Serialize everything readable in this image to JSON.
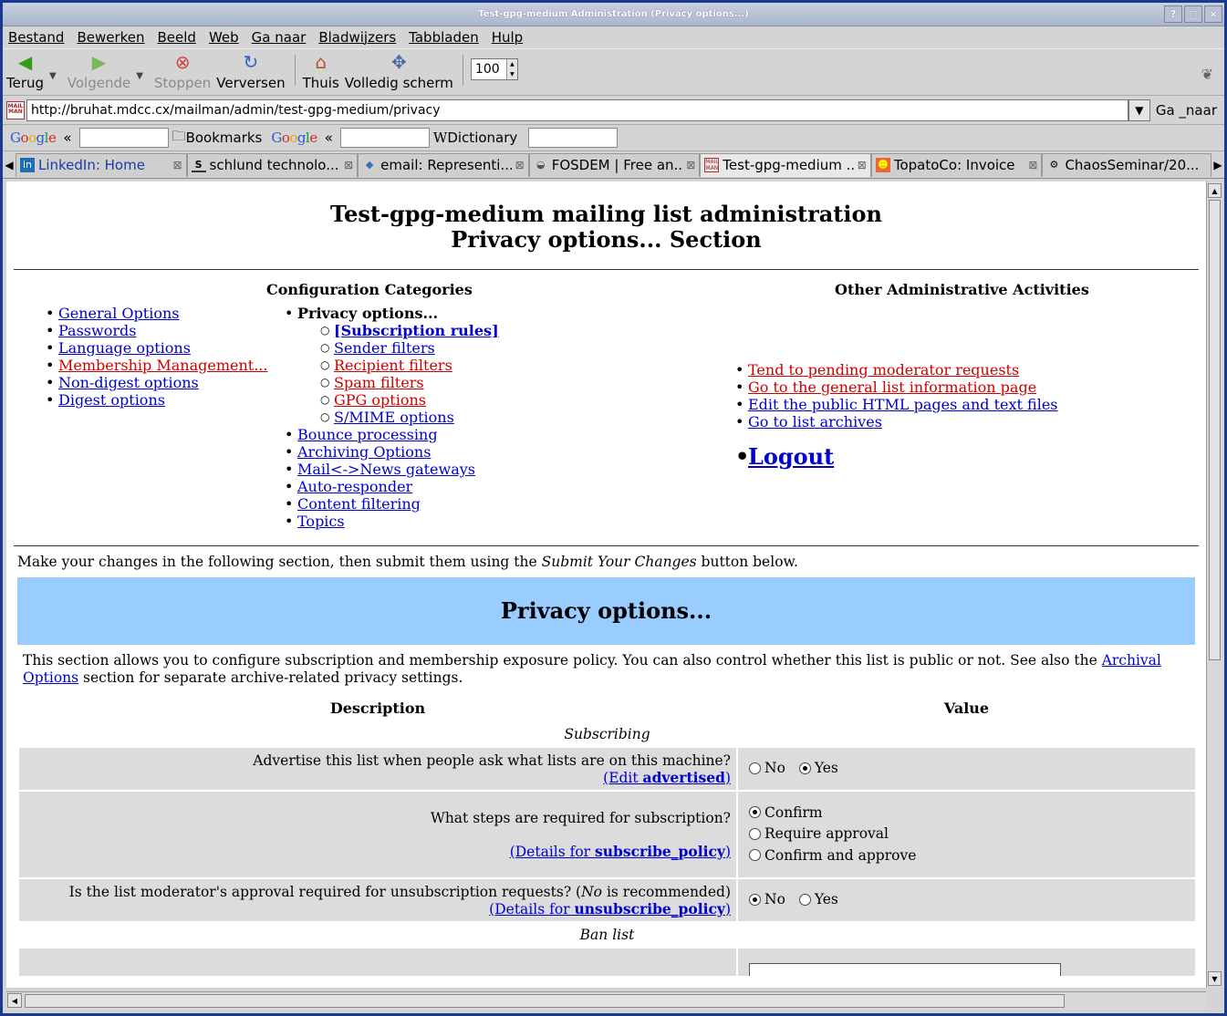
{
  "window": {
    "title": "Test-gpg-medium Administration (Privacy options...)",
    "buttons": [
      "?",
      "□",
      "×"
    ]
  },
  "menu": [
    "Bestand",
    "Bewerken",
    "Beeld",
    "Web",
    "Ga naar",
    "Bladwijzers",
    "Tabbladen",
    "Hulp"
  ],
  "toolbar": {
    "back": "Terug",
    "forward": "Volgende",
    "stop": "Stoppen",
    "reload": "Verversen",
    "home": "Thuis",
    "fullscreen": "Volledig scherm",
    "zoom": "100"
  },
  "urlbar": {
    "url": "http://bruhat.mdcc.cx/mailman/admin/test-gpg-medium/privacy",
    "go": "Ga _naar"
  },
  "searchbar": {
    "laquo": "«",
    "bookmarks": "Bookmarks",
    "dictionary": "Dictionary"
  },
  "tabs": [
    {
      "label": "LinkedIn: Home",
      "icon": "in"
    },
    {
      "label": "schlund technolo...",
      "icon": "S"
    },
    {
      "label": "email: Representi...",
      "icon": "py"
    },
    {
      "label": "FOSDEM | Free an...",
      "icon": "fo"
    },
    {
      "label": "Test-gpg-medium ...",
      "icon": "mm",
      "active": true
    },
    {
      "label": "TopatoCo: Invoice",
      "icon": "tp"
    },
    {
      "label": "ChaosSeminar/20...",
      "icon": "cs"
    }
  ],
  "page": {
    "title1": "Test-gpg-medium mailing list administration",
    "title2": "Privacy options... Section",
    "config_title": "Configuration Categories",
    "other_title": "Other Administrative Activities",
    "cats_left": [
      {
        "label": "General Options",
        "red": false
      },
      {
        "label": "Passwords",
        "red": false
      },
      {
        "label": "Language options",
        "red": false
      },
      {
        "label": "Membership Management...",
        "red": true
      },
      {
        "label": "Non-digest options",
        "red": false
      },
      {
        "label": "Digest options",
        "red": false
      }
    ],
    "privacy_heading": "Privacy options...",
    "privacy_sub": [
      {
        "label": "[Subscription rules]",
        "red": false,
        "bold": true
      },
      {
        "label": "Sender filters",
        "red": false
      },
      {
        "label": "Recipient filters",
        "red": true
      },
      {
        "label": "Spam filters",
        "red": true
      },
      {
        "label": "GPG options",
        "red": true
      },
      {
        "label": "S/MIME options",
        "red": false
      }
    ],
    "cats_mid": [
      "Bounce processing",
      "Archiving Options",
      "Mail<->News gateways",
      "Auto-responder",
      "Content filtering",
      "Topics"
    ],
    "other": [
      {
        "label": "Tend to pending moderator requests",
        "red": true
      },
      {
        "label": "Go to the general list information page",
        "red": true
      },
      {
        "label": "Edit the public HTML pages and text files",
        "red": false
      },
      {
        "label": "Go to list archives",
        "red": false
      }
    ],
    "logout": "Logout",
    "intro_pre": "Make your changes in the following section, then submit them using the ",
    "intro_em": "Submit Your Changes",
    "intro_post": " button below.",
    "section_title": "Privacy options...",
    "desc_pre": "This section allows you to configure subscription and membership exposure policy. You can also control whether this list is public or not. See also the ",
    "desc_link": "Archival Options",
    "desc_post": " section for separate archive-related privacy settings.",
    "col_desc": "Description",
    "col_value": "Value",
    "sec_subscribing": "Subscribing",
    "sec_ban": "Ban list",
    "q1": "Advertise this list when people ask what lists are on this machine?",
    "q1_link_pre": "(Edit ",
    "q1_link_b": "advertised",
    "q1_link_post": ")",
    "q1_opts": [
      "No",
      "Yes"
    ],
    "q2": "What steps are required for subscription?",
    "q2_link_pre": "(Details for ",
    "q2_link_b": "subscribe_policy",
    "q2_link_post": ")",
    "q2_opts": [
      "Confirm",
      "Require approval",
      "Confirm and approve"
    ],
    "q3_pre": "Is the list moderator's approval required for unsubscription requests? (",
    "q3_em": "No",
    "q3_post": " is recommended)",
    "q3_link_pre": "(Details for ",
    "q3_link_b": "unsubscribe_policy",
    "q3_link_post": ")",
    "q3_opts": [
      "No",
      "Yes"
    ]
  }
}
